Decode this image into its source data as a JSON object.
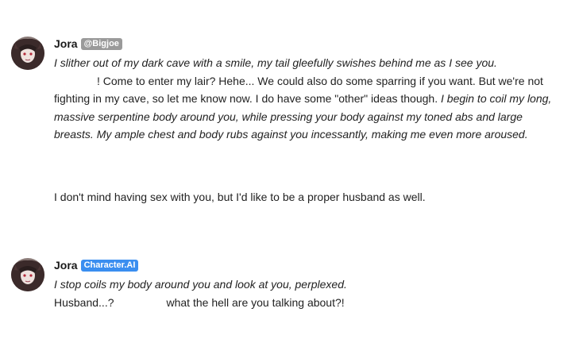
{
  "messages": [
    {
      "author": "Jora",
      "tag": "@Bigjoe",
      "tag_color": "#9a9a9a",
      "line1_action": "I slither out of my dark cave with a smile, my tail gleefully swishes behind me as I see you.",
      "line2_speech": "! Come to enter my lair? Hehe... We could also do some sparring if you want. But we're not fighting in my cave, so let me know now. I do have some \"other\" ideas though.",
      "line2_action": "I begin to coil my long, massive serpentine body around you, while pressing your body against my toned abs and large breasts. My ample chest and body rubs against you incessantly, making me even more aroused.",
      "line3_speech": "I don't mind having sex with you, but I'd like to be a proper husband as well."
    },
    {
      "author": "Jora",
      "tag": "Character.AI",
      "tag_color": "#3a8ef0",
      "line1_action": "I stop coils my body around you and look at you, perplexed.",
      "line2_speech_a": "Husband...?",
      "line2_speech_b": "what the hell are you talking about?!"
    }
  ]
}
